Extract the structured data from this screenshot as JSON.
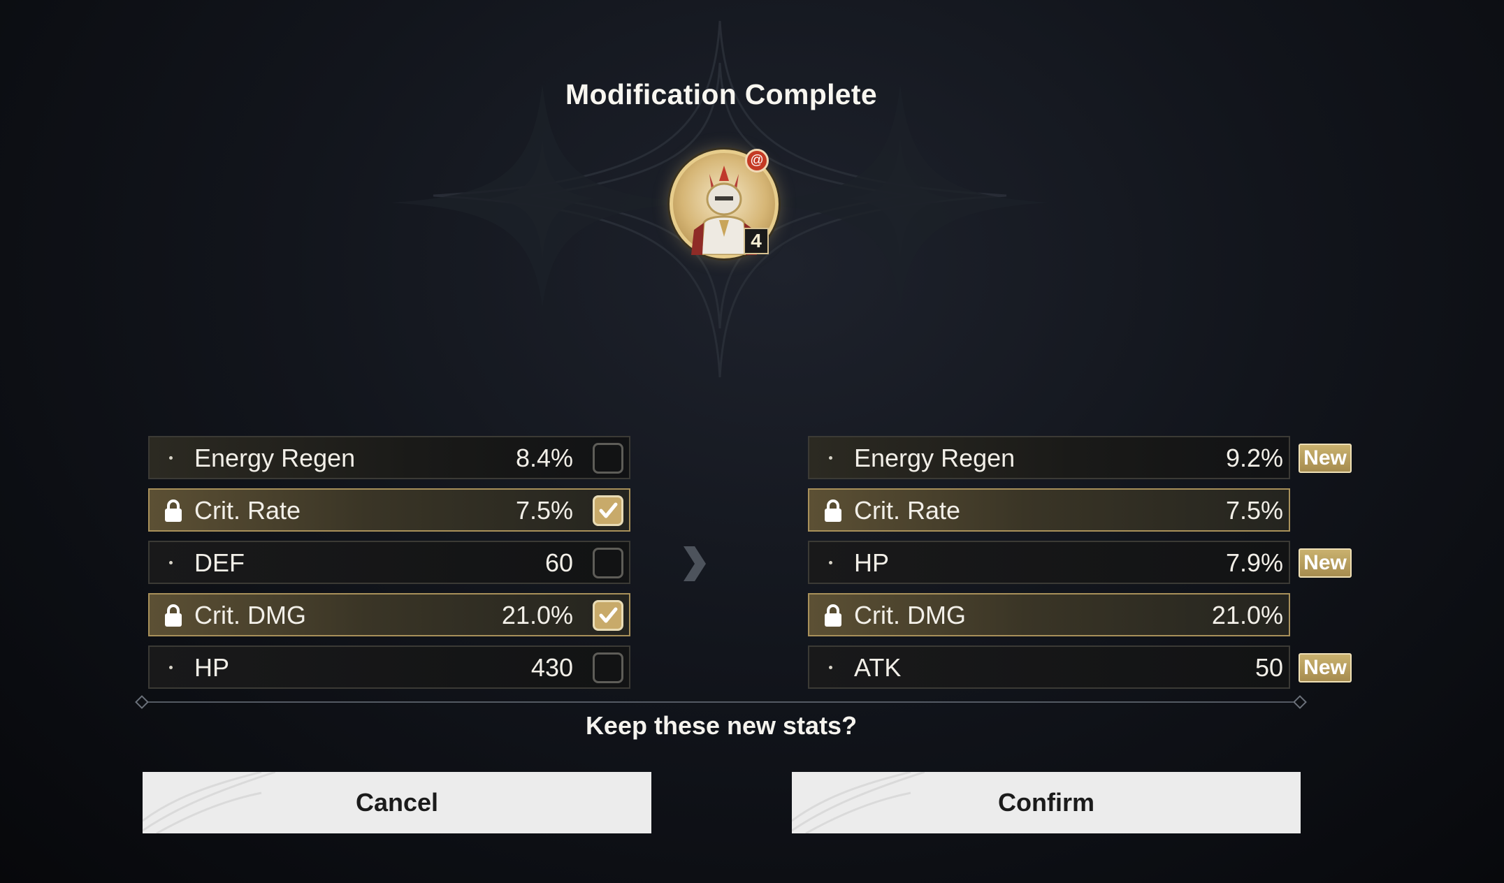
{
  "dialog": {
    "title": "Modification Complete",
    "prompt": "Keep these new stats?"
  },
  "echo": {
    "icon": "armored-knight-portrait-icon",
    "set_icon": "spiral-sonata-icon",
    "cost": "4"
  },
  "current_stats": [
    {
      "name": "Energy Regen",
      "value": "8.4%",
      "locked": false,
      "checked": false
    },
    {
      "name": "Crit. Rate",
      "value": "7.5%",
      "locked": true,
      "checked": true
    },
    {
      "name": "DEF",
      "value": "60",
      "locked": false,
      "checked": false
    },
    {
      "name": "Crit. DMG",
      "value": "21.0%",
      "locked": true,
      "checked": true
    },
    {
      "name": "HP",
      "value": "430",
      "locked": false,
      "checked": false
    }
  ],
  "new_stats": [
    {
      "name": "Energy Regen",
      "value": "9.2%",
      "locked": false,
      "badge": "New"
    },
    {
      "name": "Crit. Rate",
      "value": "7.5%",
      "locked": true,
      "badge": ""
    },
    {
      "name": "HP",
      "value": "7.9%",
      "locked": false,
      "badge": "New"
    },
    {
      "name": "Crit. DMG",
      "value": "21.0%",
      "locked": true,
      "badge": ""
    },
    {
      "name": "ATK",
      "value": "50",
      "locked": false,
      "badge": "New"
    }
  ],
  "buttons": {
    "cancel_label": "Cancel",
    "confirm_label": "Confirm"
  },
  "colors": {
    "accent_gold": "#c8aa6a",
    "locked_border": "#a8905a",
    "button_bg": "#ececec"
  }
}
